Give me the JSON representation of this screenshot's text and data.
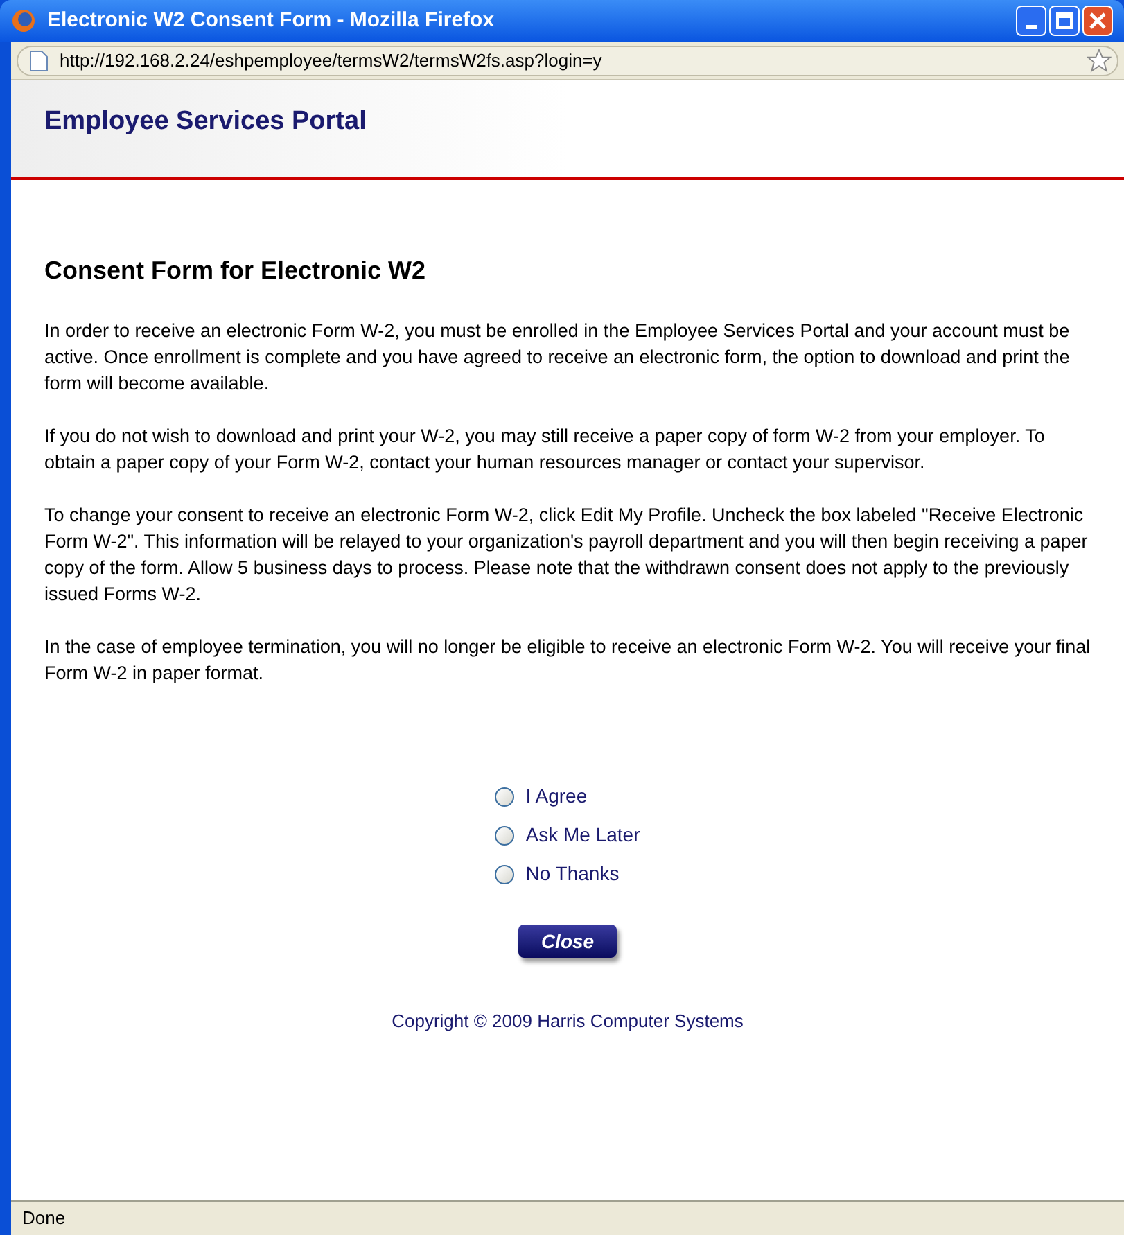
{
  "window": {
    "title": "Electronic W2 Consent Form - Mozilla Firefox"
  },
  "address_bar": {
    "url": "http://192.168.2.24/eshpemployee/termsW2/termsW2fs.asp?login=y"
  },
  "header": {
    "title": "Employee Services Portal"
  },
  "heading": "Consent Form for Electronic W2",
  "paragraphs": [
    "In order to receive an electronic Form W-2, you must be enrolled in the Employee Services Portal and your account must be active. Once enrollment is complete and you have agreed to receive an electronic form, the option to download and print the form will become available.",
    "If you do not wish to download and print your W-2, you may still receive a paper copy of form W-2 from your employer. To obtain a paper copy of your Form W-2, contact your human resources manager or contact your supervisor.",
    "To change your consent to receive an electronic Form W-2, click Edit My Profile. Uncheck the box labeled \"Receive Electronic Form W-2\". This information will be relayed to your organization's payroll department and you will then begin receiving a paper copy of the form. Allow 5 business days to process. Please note that the withdrawn consent does not apply to the previously issued Forms W-2.",
    "In the case of employee termination, you will no longer be eligible to receive an electronic Form W-2. You will receive your final Form W-2 in paper format."
  ],
  "options": [
    {
      "label": "I Agree",
      "selected": false
    },
    {
      "label": "Ask Me Later",
      "selected": false
    },
    {
      "label": "No Thanks",
      "selected": false
    }
  ],
  "close_button": "Close",
  "footer": "Copyright © 2009 Harris Computer Systems",
  "status_bar": "Done"
}
